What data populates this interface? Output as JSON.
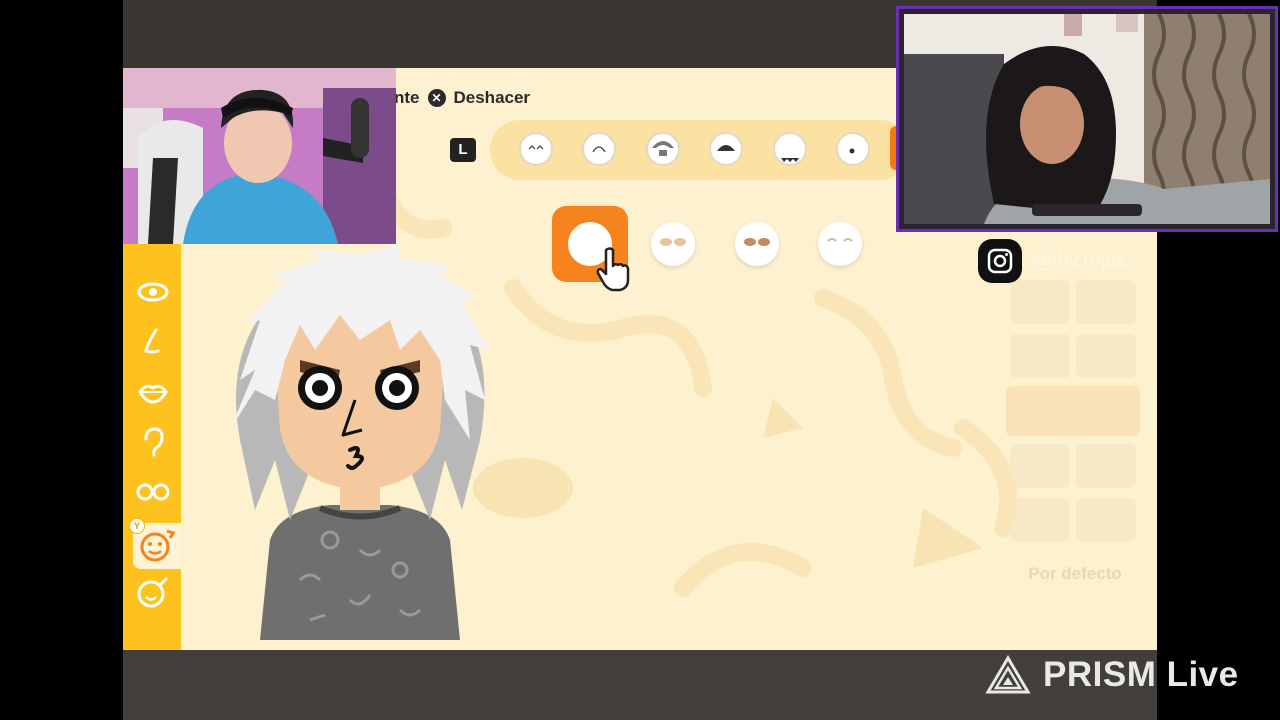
{
  "toolbar": {
    "partial_label": "nte",
    "undo_label": "Deshacer",
    "undo_button_glyph": "✕",
    "l_button": "L"
  },
  "sidebar": {
    "y_badge": "Y",
    "items": [
      "eye-icon",
      "nose-icon",
      "mouth-icon",
      "ear-icon",
      "glasses-icon",
      "face-paint-icon",
      "makeup-icon"
    ]
  },
  "tabs": [
    "face-shape-1",
    "face-shape-2",
    "face-shape-3",
    "face-shape-4",
    "face-shape-5",
    "face-shape-6"
  ],
  "options": [
    "plain-face",
    "blush-brown",
    "blush-dark",
    "eyes-closed-face"
  ],
  "default_button": "Por defecto",
  "instagram_handle": "@thv.rojas",
  "watermark": "PRISM Live",
  "colors": {
    "accent_orange": "#f5841f",
    "sidebar_yellow": "#fdc21e",
    "canvas_cream": "#fdf1cf",
    "frame_purple": "#6b2fb5"
  }
}
